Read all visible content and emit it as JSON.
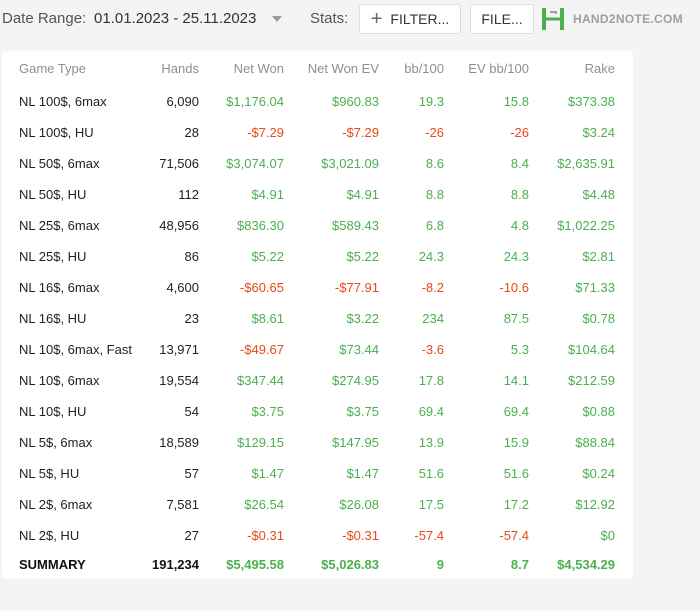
{
  "toolbar": {
    "date_range_label": "Date Range:",
    "date_range_value": "01.01.2023 - 25.11.2023",
    "stats_label": "Stats:",
    "filter_button": "FILTER...",
    "file_button": "FILE...",
    "logo_text": "HAND2NOTE.COM"
  },
  "colors": {
    "positive": "#4caf50",
    "negative": "#e64a19",
    "header": "#8b8f95"
  },
  "table": {
    "headers": [
      "Game Type",
      "Hands",
      "Net Won",
      "Net Won  EV",
      "bb/100",
      "EV bb/100",
      "Rake"
    ],
    "rows": [
      [
        "NL 100$, 6max",
        "6,090",
        "$1,176.04",
        "$960.83",
        "19.3",
        "15.8",
        "$373.38"
      ],
      [
        "NL 100$, HU",
        "28",
        "-$7.29",
        "-$7.29",
        "-26",
        "-26",
        "$3.24"
      ],
      [
        "NL 50$, 6max",
        "71,506",
        "$3,074.07",
        "$3,021.09",
        "8.6",
        "8.4",
        "$2,635.91"
      ],
      [
        "NL 50$, HU",
        "112",
        "$4.91",
        "$4.91",
        "8.8",
        "8.8",
        "$4.48"
      ],
      [
        "NL 25$, 6max",
        "48,956",
        "$836.30",
        "$589.43",
        "6.8",
        "4.8",
        "$1,022.25"
      ],
      [
        "NL 25$, HU",
        "86",
        "$5.22",
        "$5.22",
        "24.3",
        "24.3",
        "$2.81"
      ],
      [
        "NL 16$, 6max",
        "4,600",
        "-$60.65",
        "-$77.91",
        "-8.2",
        "-10.6",
        "$71.33"
      ],
      [
        "NL 16$, HU",
        "23",
        "$8.61",
        "$3.22",
        "234",
        "87.5",
        "$0.78"
      ],
      [
        "NL 10$, 6max, Fast",
        "13,971",
        "-$49.67",
        "$73.44",
        "-3.6",
        "5.3",
        "$104.64"
      ],
      [
        "NL 10$, 6max",
        "19,554",
        "$347.44",
        "$274.95",
        "17.8",
        "14.1",
        "$212.59"
      ],
      [
        "NL 10$, HU",
        "54",
        "$3.75",
        "$3.75",
        "69.4",
        "69.4",
        "$0.88"
      ],
      [
        "NL 5$, 6max",
        "18,589",
        "$129.15",
        "$147.95",
        "13.9",
        "15.9",
        "$88.84"
      ],
      [
        "NL 5$, HU",
        "57",
        "$1.47",
        "$1.47",
        "51.6",
        "51.6",
        "$0.24"
      ],
      [
        "NL 2$, 6max",
        "7,581",
        "$26.54",
        "$26.08",
        "17.5",
        "17.2",
        "$12.92"
      ],
      [
        "NL 2$, HU",
        "27",
        "-$0.31",
        "-$0.31",
        "-57.4",
        "-57.4",
        "$0"
      ]
    ],
    "summary": [
      "SUMMARY",
      "191,234",
      "$5,495.58",
      "$5,026.83",
      "9",
      "8.7",
      "$4,534.29"
    ]
  }
}
